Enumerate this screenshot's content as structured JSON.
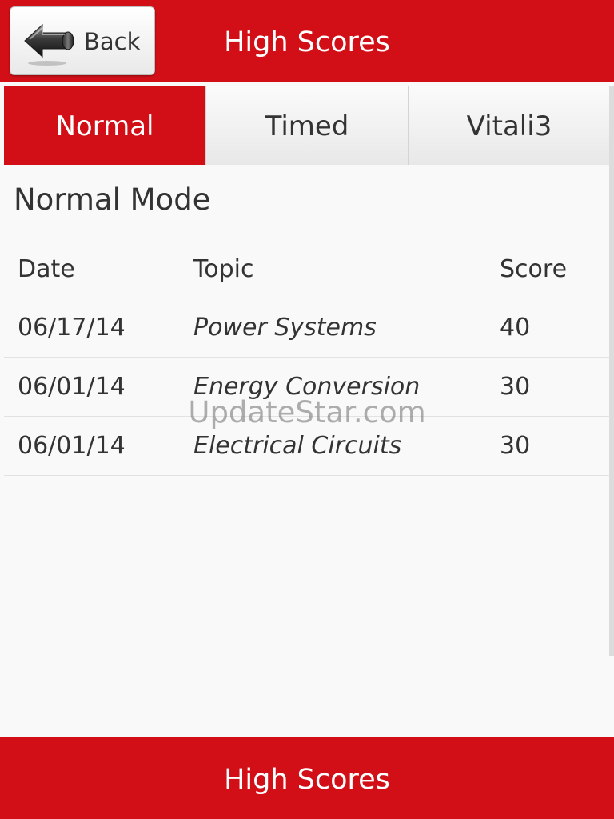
{
  "header": {
    "back_label": "Back",
    "title": "High Scores"
  },
  "tabs": [
    {
      "label": "Normal",
      "active": true
    },
    {
      "label": "Timed",
      "active": false
    },
    {
      "label": "Vitali3",
      "active": false
    }
  ],
  "section": {
    "title": "Normal Mode"
  },
  "table": {
    "columns": {
      "date": "Date",
      "topic": "Topic",
      "score": "Score"
    },
    "rows": [
      {
        "date": "06/17/14",
        "topic": "Power Systems",
        "score": "40"
      },
      {
        "date": "06/01/14",
        "topic": "Energy Conversion",
        "score": "30"
      },
      {
        "date": "06/01/14",
        "topic": "Electrical Circuits",
        "score": "30"
      }
    ]
  },
  "watermark": "UpdateStar.com",
  "footer": {
    "title": "High Scores"
  },
  "colors": {
    "brand_red": "#d20f17",
    "text": "#333333",
    "background": "#f9f9f9"
  },
  "icons": {
    "back": "arrow-left-icon"
  }
}
